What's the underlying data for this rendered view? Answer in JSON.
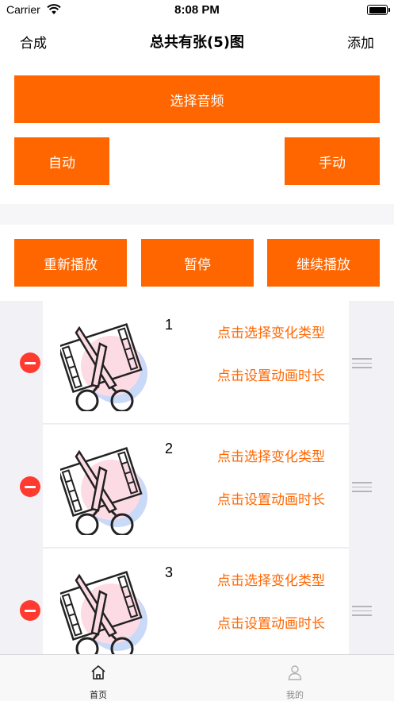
{
  "status_bar": {
    "carrier": "Carrier",
    "time": "8:08 PM"
  },
  "nav": {
    "left": "合成",
    "title": "总共有张(5)图",
    "right": "添加"
  },
  "buttons": {
    "select_audio": "选择音频",
    "auto": "自动",
    "manual": "手动",
    "replay": "重新播放",
    "pause": "暂停",
    "continue": "继续播放"
  },
  "rows": [
    {
      "index": "1",
      "change_type": "点击选择变化类型",
      "set_duration": "点击设置动画时长"
    },
    {
      "index": "2",
      "change_type": "点击选择变化类型",
      "set_duration": "点击设置动画时长"
    },
    {
      "index": "3",
      "change_type": "点击选择变化类型",
      "set_duration": "点击设置动画时长"
    }
  ],
  "tabs": [
    {
      "label": "首页",
      "icon": "home-icon",
      "active": true
    },
    {
      "label": "我的",
      "icon": "person-icon",
      "active": false
    }
  ],
  "colors": {
    "accent": "#ff6600",
    "delete": "#ff3b30"
  }
}
